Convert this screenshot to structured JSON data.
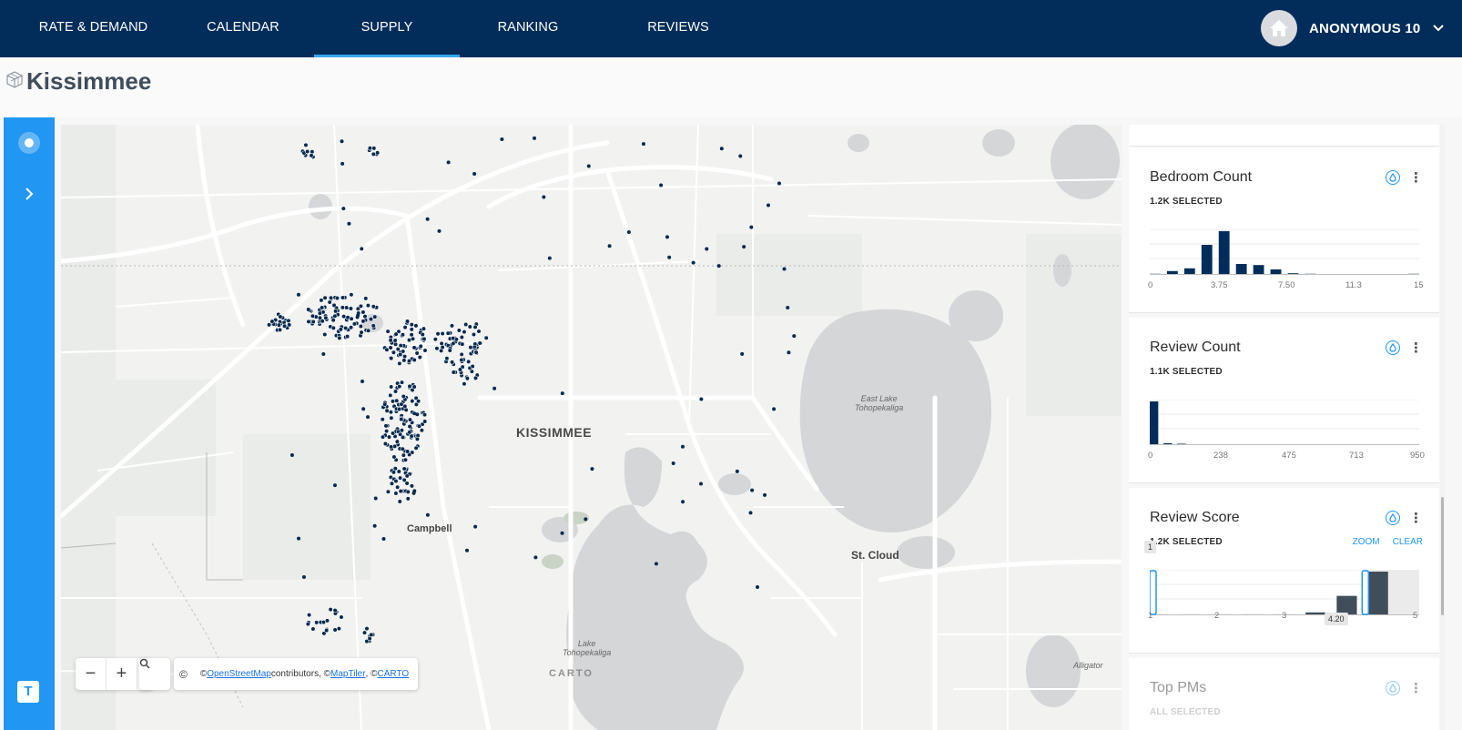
{
  "nav": {
    "tabs": [
      {
        "label": "RATE & DEMAND"
      },
      {
        "label": "CALENDAR"
      },
      {
        "label": "SUPPLY",
        "active": true
      },
      {
        "label": "RANKING"
      },
      {
        "label": "REVIEWS"
      }
    ],
    "user": {
      "name": "ANONYMOUS 10",
      "icon": "home-icon"
    }
  },
  "page": {
    "title": "Kissimmee"
  },
  "map": {
    "labels": {
      "city": "KISSIMMEE",
      "campbell": "Campbell",
      "st_cloud": "St. Cloud",
      "east_lake": "East Lake\nTohopekaliga",
      "east_lake_1": "East Lake",
      "east_lake_2": "Tohopekaliga",
      "lake_toho_1": "Lake",
      "lake_toho_2": "Tohopekaliga",
      "alligator": "Alligator"
    },
    "controls": {
      "zoom_out": "−",
      "zoom_in": "+",
      "copyright_btn": "©"
    },
    "attribution": {
      "prefix": "© ",
      "osm": "OpenStreetMap",
      "mid1": " contributors, © ",
      "maptiler": "MapTiler",
      "mid2": ", © ",
      "carto": "CARTO"
    },
    "watermark": "CARTO",
    "point_color": "#0a2a4e"
  },
  "widgets": {
    "bedroom": {
      "title": "Bedroom Count",
      "selected": "1.2K SELECTED",
      "ticks": [
        "0",
        "3.75",
        "7.50",
        "11.3",
        "15"
      ]
    },
    "review_count": {
      "title": "Review Count",
      "selected": "1.1K SELECTED",
      "ticks": [
        "0",
        "238",
        "475",
        "713",
        "950"
      ]
    },
    "review_score": {
      "title": "Review Score",
      "selected": "1.2K SELECTED",
      "zoom_label": "ZOOM",
      "clear_label": "CLEAR",
      "range_min": "1",
      "range_max": "4.20",
      "ticks": [
        "1",
        "2",
        "3",
        "4",
        "5"
      ]
    },
    "top_pms": {
      "title": "Top PMs",
      "selected": "ALL SELECTED"
    }
  },
  "chart_data": [
    {
      "type": "bar",
      "title": "Bedroom Count",
      "x": [
        0,
        1,
        2,
        3,
        4,
        5,
        6,
        7,
        8,
        9,
        10,
        15
      ],
      "values": [
        2,
        7,
        12,
        55,
        80,
        20,
        18,
        10,
        3,
        2,
        1,
        2
      ],
      "xlim": [
        0,
        15
      ],
      "color": "#022d5a"
    },
    {
      "type": "bar",
      "title": "Review Count",
      "x": [
        0,
        50,
        100,
        150,
        200,
        300,
        600
      ],
      "values": [
        95,
        4,
        3,
        2,
        2,
        1,
        1
      ],
      "xlim": [
        0,
        950
      ],
      "color": "#022d5a"
    },
    {
      "type": "bar",
      "title": "Review Score",
      "x": [
        1,
        1.5,
        2,
        2.5,
        3,
        3.5,
        4,
        4.5
      ],
      "values": [
        1,
        1,
        1,
        1,
        1,
        3,
        20,
        45
      ],
      "xlim": [
        1,
        5
      ],
      "selected_range": [
        1,
        4.2
      ],
      "color": "#404d5b"
    }
  ]
}
